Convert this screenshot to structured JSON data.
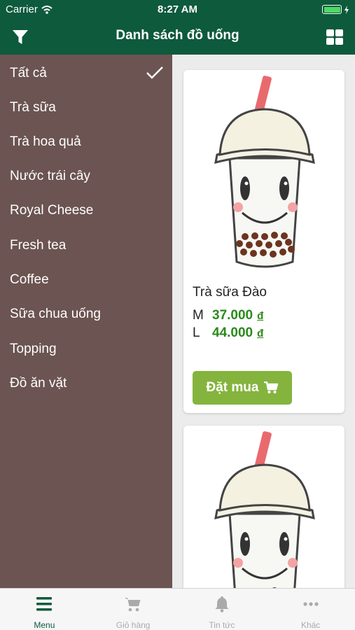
{
  "status_bar": {
    "carrier": "Carrier",
    "time": "8:27 AM"
  },
  "nav": {
    "title": "Danh sách đồ uống",
    "left_icon": "filter-icon",
    "right_icon": "grid-icon"
  },
  "categories": [
    {
      "label": "Tất cả",
      "selected": true
    },
    {
      "label": "Trà sữa"
    },
    {
      "label": "Trà hoa quả"
    },
    {
      "label": "Nước trái cây"
    },
    {
      "label": "Royal Cheese"
    },
    {
      "label": "Fresh tea"
    },
    {
      "label": "Coffee"
    },
    {
      "label": "Sữa chua uống"
    },
    {
      "label": "Topping"
    },
    {
      "label": "Đồ ăn vặt"
    }
  ],
  "products": [
    {
      "name": "Trà sữa Đào",
      "prices": [
        {
          "size": "M",
          "amount": "37.000",
          "currency": "đ"
        },
        {
          "size": "L",
          "amount": "44.000",
          "currency": "đ"
        }
      ],
      "button": "Đặt mua",
      "image_icon": "bubble-tea-cup-icon"
    },
    {
      "image_icon": "bubble-tea-cup-icon"
    }
  ],
  "tabs": [
    {
      "label": "Menu",
      "icon": "menu-icon",
      "active": true
    },
    {
      "label": "Giỏ hàng",
      "icon": "cart-icon"
    },
    {
      "label": "Tin tức",
      "icon": "bell-icon"
    },
    {
      "label": "Khác",
      "icon": "more-icon"
    }
  ],
  "colors": {
    "primary": "#0e5a3c",
    "sidebar": "#6b5451",
    "price": "#2a8a19",
    "button": "#84b43d",
    "tab_inactive": "#aaaaaa"
  }
}
